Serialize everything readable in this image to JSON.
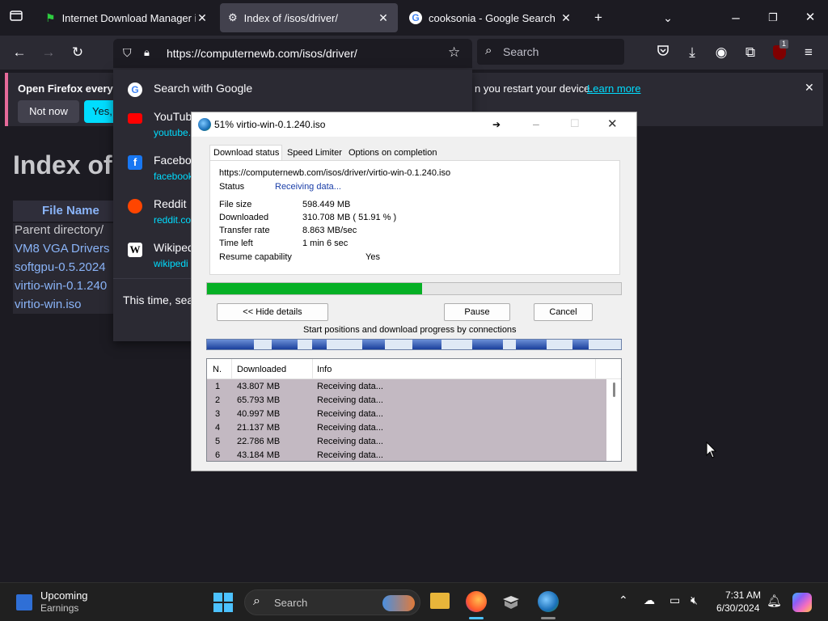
{
  "browser": {
    "tabs": [
      {
        "title": "Internet Download Manager is a",
        "active": false
      },
      {
        "title": "Index of /isos/driver/",
        "active": true
      },
      {
        "title": "cooksonia - Google Search",
        "active": false
      }
    ],
    "url": "https://computernewb.com/isos/driver/",
    "search_placeholder": "Search",
    "extension_badge": "1"
  },
  "notification": {
    "title": "Open Firefox every ti",
    "message_tail": "n you restart your device.",
    "learn_more": "Learn more",
    "not_now": "Not now",
    "yes_label": "Yes, c"
  },
  "url_dropdown": {
    "search_with": "Search with Google",
    "suggestions": [
      {
        "name": "YouTub",
        "url": "youtube."
      },
      {
        "name": "Faceboo",
        "url": "facebook"
      },
      {
        "name": "Reddit",
        "url": "reddit.co"
      },
      {
        "name": "Wikiped",
        "url": "wikipedi"
      }
    ],
    "footer": "This time, sear"
  },
  "page": {
    "heading": "Index of",
    "column_header": "File Name",
    "files": [
      "Parent directory/",
      "VM8 VGA Drivers",
      "softgpu-0.5.2024",
      "virtio-win-0.1.240",
      "virtio-win.iso"
    ]
  },
  "idm": {
    "title": "51% virtio-win-0.1.240.iso",
    "tabs": [
      "Download status",
      "Speed Limiter",
      "Options on completion"
    ],
    "url": "https://computernewb.com/isos/driver/virtio-win-0.1.240.iso",
    "status_label": "Status",
    "status_value": "Receiving data...",
    "rows": [
      {
        "label": "File size",
        "value": "598.449  MB"
      },
      {
        "label": "Downloaded",
        "value": "310.708  MB  ( 51.91 % )"
      },
      {
        "label": "Transfer rate",
        "value": "8.863  MB/sec"
      },
      {
        "label": "Time left",
        "value": "1 min 6 sec"
      },
      {
        "label": "Resume capability",
        "value": "Yes"
      }
    ],
    "progress": 0.5191,
    "hide_details": "<< Hide details",
    "pause": "Pause",
    "cancel": "Cancel",
    "connections_caption": "Start positions and download progress by connections",
    "table_headers": [
      "N.",
      "Downloaded",
      "Info"
    ],
    "connections": [
      {
        "n": "1",
        "downloaded": "43.807  MB",
        "info": "Receiving data..."
      },
      {
        "n": "2",
        "downloaded": "65.793  MB",
        "info": "Receiving data..."
      },
      {
        "n": "3",
        "downloaded": "40.997  MB",
        "info": "Receiving data..."
      },
      {
        "n": "4",
        "downloaded": "21.137  MB",
        "info": "Receiving data..."
      },
      {
        "n": "5",
        "downloaded": "22.786  MB",
        "info": "Receiving data..."
      },
      {
        "n": "6",
        "downloaded": "43.184  MB",
        "info": "Receiving data..."
      }
    ]
  },
  "taskbar": {
    "widget_title": "Upcoming",
    "widget_sub": "Earnings",
    "search_placeholder": "Search",
    "time": "7:31 AM",
    "date": "6/30/2024"
  },
  "colors": {
    "accent_blue": "#00ddff",
    "progress_green": "#06b025",
    "link_blue": "#8ab4f8"
  }
}
